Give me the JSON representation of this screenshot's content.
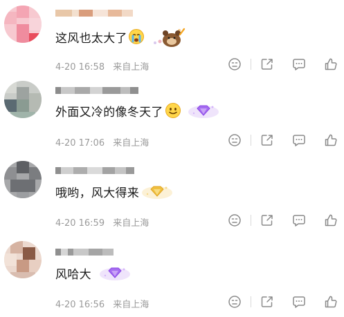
{
  "comments": [
    {
      "text": "这风也太大了",
      "time": "4-20 16:58",
      "location": "来自上海",
      "emoji": "crying-emoji",
      "badge": "bear-sticker"
    },
    {
      "text": "外面又冷的像冬天了",
      "time": "4-20 17:06",
      "location": "来自上海",
      "emoji": "smile-emoji",
      "badge": "purple-diamond-badge"
    },
    {
      "text": "哦哟，风大得来",
      "time": "4-20 16:59",
      "location": "来自上海",
      "emoji": "",
      "badge": "gold-diamond-badge"
    },
    {
      "text": "风哈大",
      "time": "4-20 16:56",
      "location": "来自上海",
      "emoji": "",
      "badge": "purple-diamond-badge"
    }
  ],
  "actions": [
    "face-icon",
    "repost-icon",
    "comment-icon",
    "like-icon"
  ],
  "colors": {
    "meta_text": "#9a9a9a",
    "icon_stroke": "#8a8a8a",
    "purple_badge": "#a56cf0",
    "gold_badge": "#f0c040"
  }
}
